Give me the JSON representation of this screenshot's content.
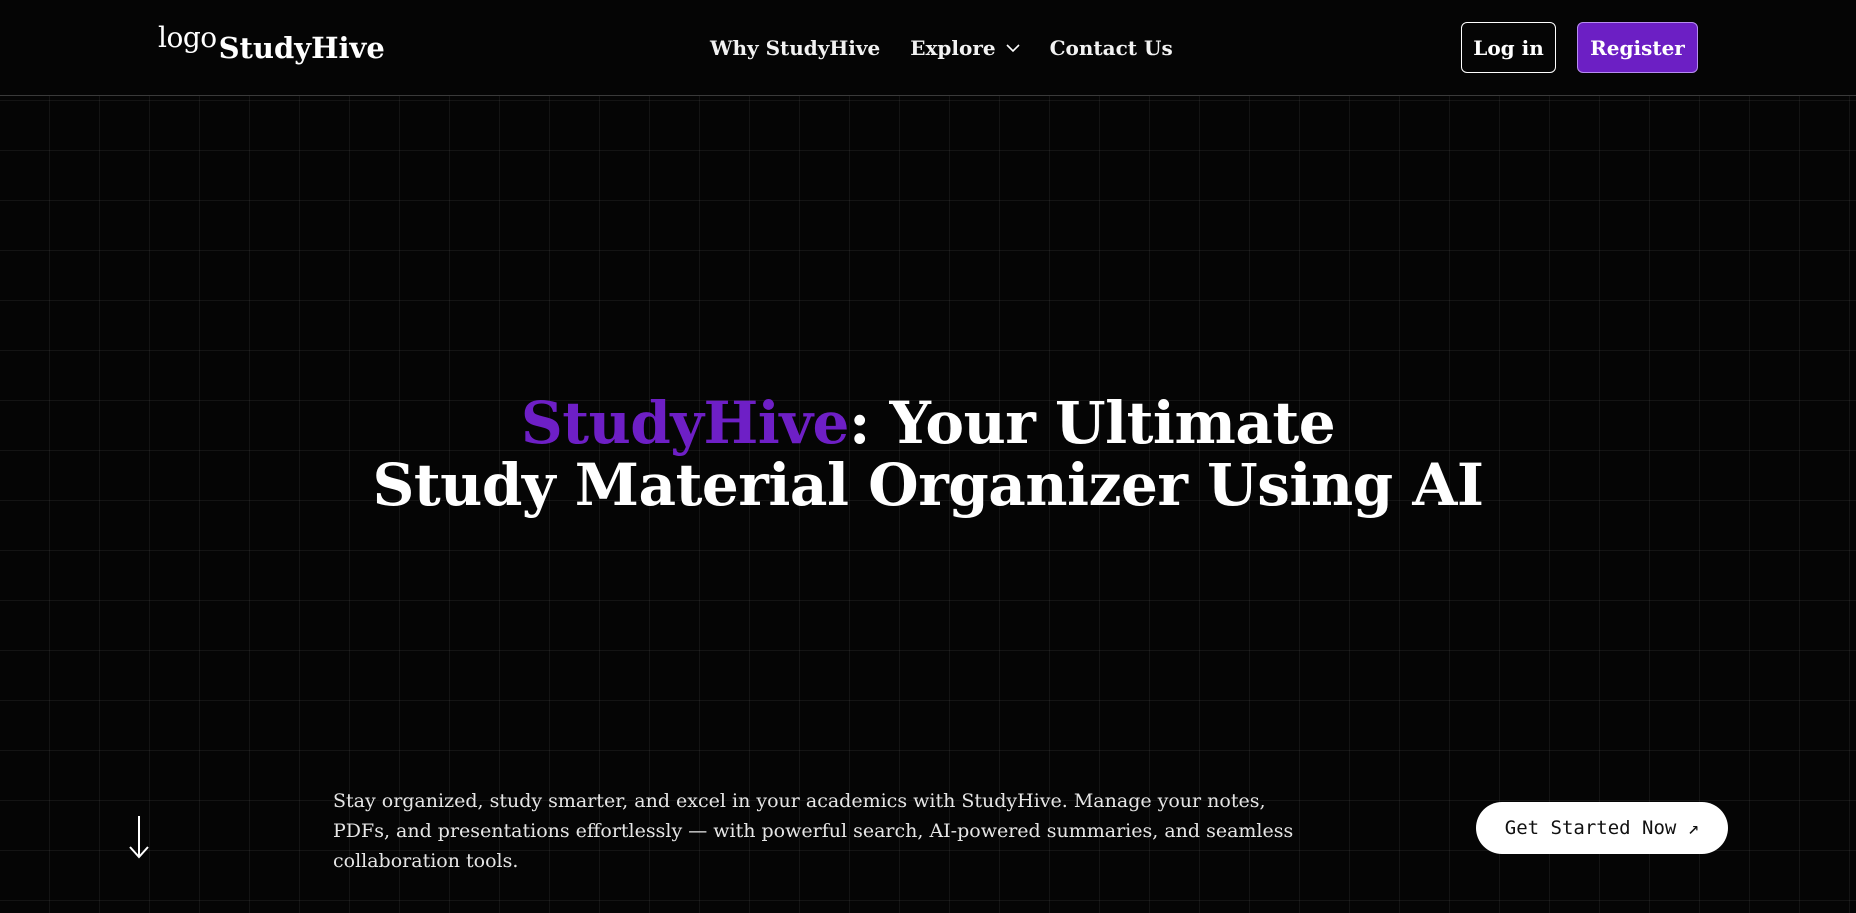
{
  "brand": {
    "logo_text": "logo",
    "name": "StudyHive"
  },
  "nav": {
    "items": [
      {
        "label": "Why StudyHive"
      },
      {
        "label": "Explore",
        "has_dropdown": true
      },
      {
        "label": "Contact Us"
      }
    ]
  },
  "auth": {
    "login_label": "Log in",
    "register_label": "Register"
  },
  "hero": {
    "title_accent": "StudyHive",
    "title_rest_line1": ": Your Ultimate",
    "title_line2": "Study Material Organizer Using AI"
  },
  "description": "Stay organized, study smarter, and excel in your academics with StudyHive. Manage your notes, PDFs, and presentations effortlessly — with powerful search, AI-powered summaries, and seamless collaboration tools.",
  "cta": {
    "label": "Get Started Now ↗"
  },
  "icons": {
    "explore_dropdown": "chevron-down-icon",
    "scroll": "arrow-down-icon"
  },
  "colors": {
    "accent": "#6e1fc6",
    "register_bg": "#6c1fc4",
    "background": "#050505"
  }
}
